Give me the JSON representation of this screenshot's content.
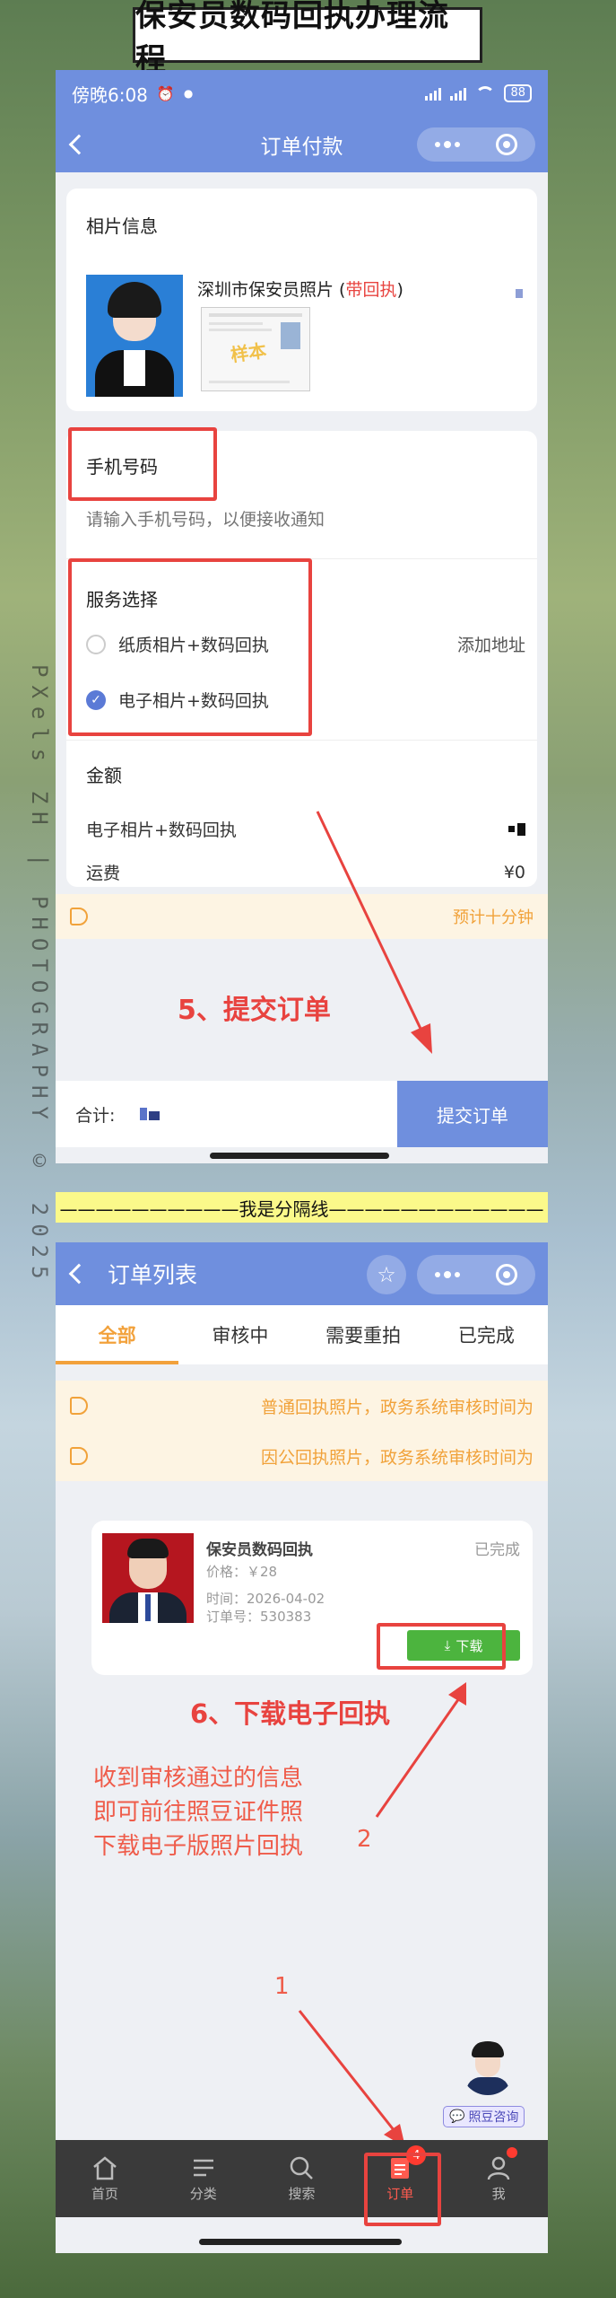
{
  "banner_title": "保安员数码回执办理流程",
  "watermark": "PXels ZH | PHOTOGRAPHY © 2025",
  "order_pay": {
    "status_time": "傍晚6:08",
    "battery": "88",
    "title": "订单付款",
    "photo_info_label": "相片信息",
    "product_name": "深圳市保安员照片 (",
    "product_tag": "带回执",
    "product_close": ")",
    "stamp_text": "样本",
    "phone_label": "手机号码",
    "phone_placeholder": "请输入手机号码，以便接收通知",
    "service_label": "服务选择",
    "service_options": [
      {
        "label": "纸质相片+数码回执",
        "checked": false,
        "extra": "添加地址"
      },
      {
        "label": "电子相片+数码回执",
        "checked": true,
        "extra": ""
      }
    ],
    "amount_label": "金额",
    "amount_rows": [
      {
        "label": "电子相片+数码回执",
        "value": ""
      },
      {
        "label": "运费",
        "value": "¥0"
      }
    ],
    "notice_right": "预计十分钟",
    "step_annotation": "5、提交订单",
    "total_label": "合计:",
    "submit_label": "提交订单"
  },
  "divider_text": "——————————我是分隔线————————————",
  "order_list": {
    "title": "订单列表",
    "tabs": [
      "全部",
      "审核中",
      "需要重拍",
      "已完成"
    ],
    "notices": [
      "普通回执照片，政务系统审核时间为",
      "因公回执照片，政务系统审核时间为"
    ],
    "order": {
      "name": "保安员数码回执",
      "status": "已完成",
      "price": "价格：￥28",
      "time": "时间：2026-04-02",
      "order_no": "订单号：530383",
      "download_label": "下载"
    },
    "step_annotation": "6、下载电子回执",
    "instructions": [
      "收到审核通过的信息",
      "即可前往照豆证件照",
      "下载电子版照片回执"
    ],
    "marker_1": "1",
    "marker_2": "2",
    "consult_label": "照豆咨询",
    "tabbar": [
      {
        "label": "首页",
        "icon": "home-icon"
      },
      {
        "label": "分类",
        "icon": "list-icon"
      },
      {
        "label": "搜索",
        "icon": "search-icon"
      },
      {
        "label": "订单",
        "icon": "order-icon",
        "badge": "4"
      },
      {
        "label": "我",
        "icon": "user-icon"
      }
    ]
  },
  "colors": {
    "header": "#6f8fde",
    "annotation_red": "#e8433f",
    "accent_orange": "#f2a13b",
    "download_green": "#4cb43e"
  }
}
